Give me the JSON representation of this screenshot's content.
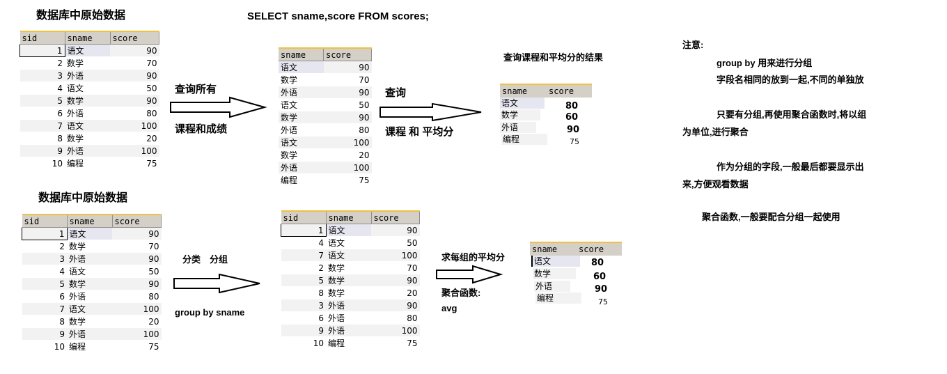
{
  "title_top": "数据库中原始数据",
  "title_bottom": "数据库中原始数据",
  "sql": "SELECT sname,score FROM scores;",
  "table_cols": {
    "sid": "sid",
    "sname": "sname",
    "score": "score"
  },
  "raw_rows": [
    {
      "sid": "1",
      "sname": "语文",
      "score": "90"
    },
    {
      "sid": "2",
      "sname": "数学",
      "score": "70"
    },
    {
      "sid": "3",
      "sname": "外语",
      "score": "90"
    },
    {
      "sid": "4",
      "sname": "语文",
      "score": "50"
    },
    {
      "sid": "5",
      "sname": "数学",
      "score": "90"
    },
    {
      "sid": "6",
      "sname": "外语",
      "score": "80"
    },
    {
      "sid": "7",
      "sname": "语文",
      "score": "100"
    },
    {
      "sid": "8",
      "sname": "数学",
      "score": "20"
    },
    {
      "sid": "9",
      "sname": "外语",
      "score": "100"
    },
    {
      "sid": "10",
      "sname": "编程",
      "score": "75"
    }
  ],
  "grouped_rows": [
    {
      "sid": "1",
      "sname": "语文",
      "score": "90"
    },
    {
      "sid": "4",
      "sname": "语文",
      "score": "50"
    },
    {
      "sid": "7",
      "sname": "语文",
      "score": "100"
    },
    {
      "sid": "2",
      "sname": "数学",
      "score": "70"
    },
    {
      "sid": "5",
      "sname": "数学",
      "score": "90"
    },
    {
      "sid": "8",
      "sname": "数学",
      "score": "20"
    },
    {
      "sid": "3",
      "sname": "外语",
      "score": "90"
    },
    {
      "sid": "6",
      "sname": "外语",
      "score": "80"
    },
    {
      "sid": "9",
      "sname": "外语",
      "score": "100"
    },
    {
      "sid": "10",
      "sname": "编程",
      "score": "75"
    }
  ],
  "arrow1_top": "查询所有",
  "arrow1_bottom": "课程和成绩",
  "arrow2_top": "查询",
  "arrow2_bottom": "课程 和 平均分",
  "result_title": "查询课程和平均分的结果",
  "result_rows": [
    {
      "sname": "语文",
      "score": "80"
    },
    {
      "sname": "数学",
      "score": "60"
    },
    {
      "sname": "外语",
      "score": "90"
    },
    {
      "sname": "编程",
      "score": "75"
    }
  ],
  "arrow3_top": "分类　分组",
  "arrow3_bottom": "group by sname",
  "arrow4_top": "求每组的平均分",
  "arrow4_mid": "聚合函数:",
  "arrow4_bottom": "avg",
  "notes": {
    "title": "注意:",
    "line1": "group by 用来进行分组",
    "line2": "字段名相同的放到一起,不同的单独放",
    "line3": "只要有分组,再使用聚合函数时,将以组",
    "line4": "为单位,进行聚合",
    "line5": "作为分组的字段,一般最后都要显示出",
    "line6": "来,方便观看数据",
    "line7": "聚合函数,一般要配合分组一起使用"
  }
}
